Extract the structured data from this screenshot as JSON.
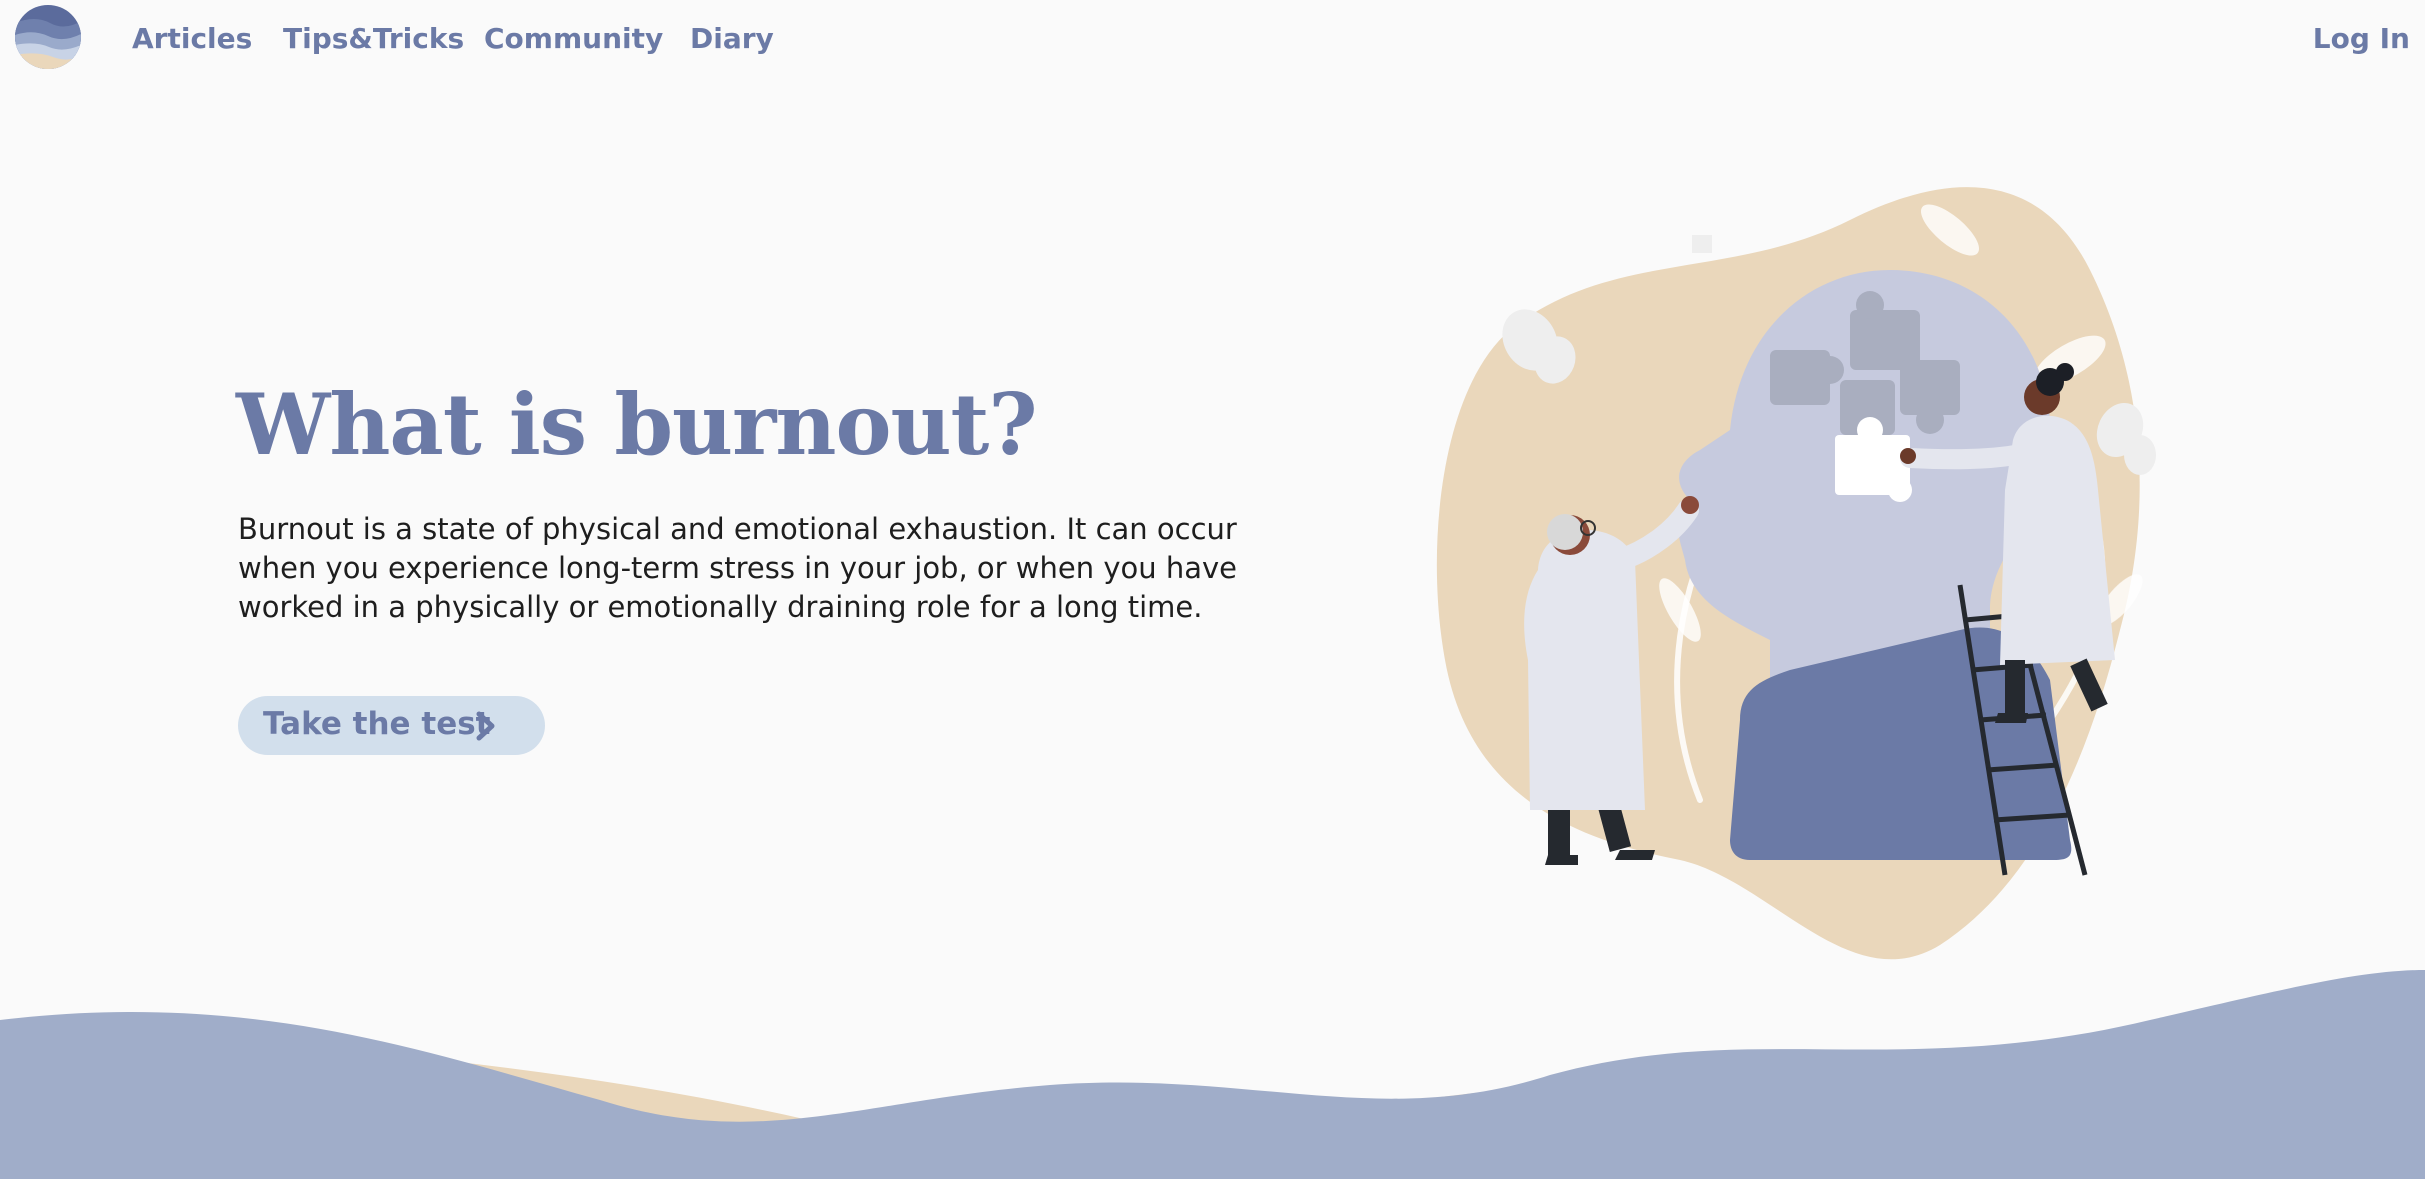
{
  "nav": {
    "logo": "logo-icon",
    "links": [
      {
        "label": "Articles"
      },
      {
        "label": "Tips&Tricks"
      },
      {
        "label": "Community"
      },
      {
        "label": "Diary"
      }
    ],
    "login_label": "Log In"
  },
  "hero": {
    "title": "What is burnout?",
    "text": "Burnout is a state of physical and emotional exhaustion. It can occur when you experience long-term stress in your job, or when you have worked in a physically or emotionally draining role for a long time.",
    "cta_label": "Take the test",
    "cta_icon": "chevron-right-icon"
  },
  "colors": {
    "accent": "#6b7aa6",
    "cta_bg": "#d2dfec",
    "sand": "#ead7bb",
    "wave": "#a0adc9",
    "background": "#fafafa"
  }
}
